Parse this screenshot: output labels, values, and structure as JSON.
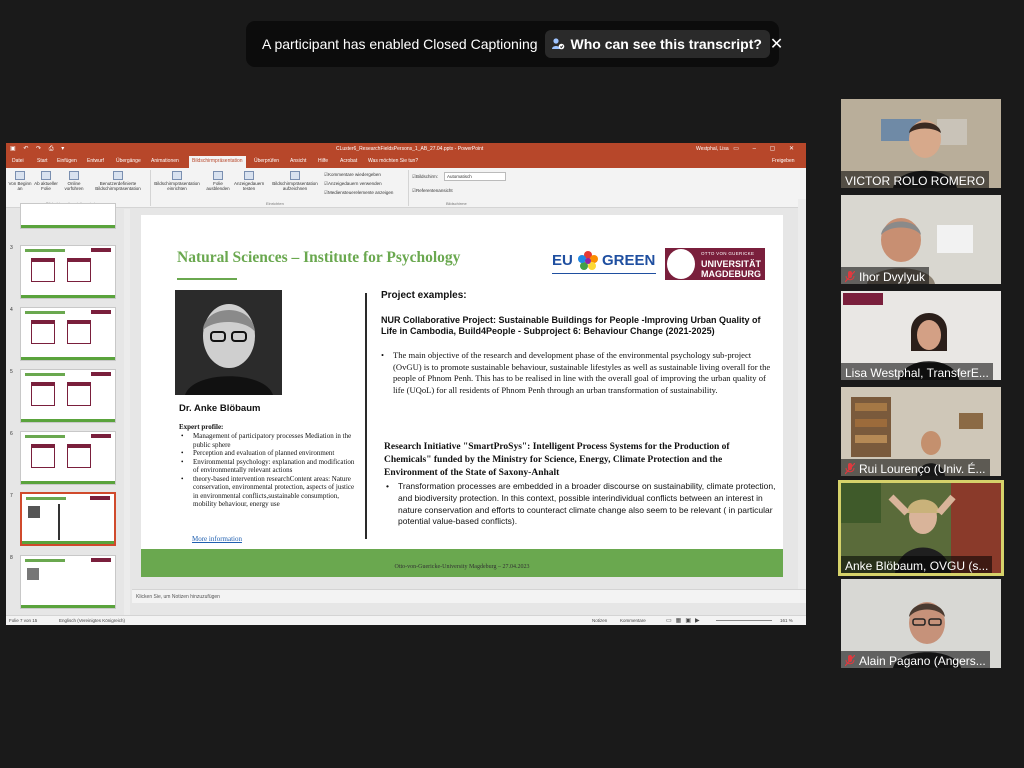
{
  "caption_banner": {
    "message": "A participant has enabled Closed Captioning",
    "transcript_button": "Who can see this transcript?",
    "close_icon": "close-icon"
  },
  "powerpoint": {
    "title": "CLuster6_ResearchFieldsPersons_1_AB_27.04.pptx  -  PowerPoint",
    "user": "Westphal, Lisa",
    "tabs": [
      "Datei",
      "Start",
      "Einfügen",
      "Entwurf",
      "Übergänge",
      "Animationen",
      "Bildschirmpräsentation",
      "Überprüfen",
      "Ansicht",
      "Hilfe",
      "Acrobat",
      "Was möchten Sie tun?",
      "Freigeben"
    ],
    "active_tab": "Bildschirmpräsentation",
    "ribbon": {
      "buttons": [
        "Von Beginn an",
        "Ab aktueller Folie",
        "Online vorführen",
        "Benutzerdefinierte Bildschirmpräsentation",
        "Bildschirmpräsentation einrichten",
        "Folie ausblenden",
        "Anzeigedauern testen",
        "Bildschirmpräsentation aufzeichnen"
      ],
      "checkboxes": [
        "Kommentare wiedergeben",
        "Anzeigedauern verwenden",
        "Medien­steuer­elemente anzeigen",
        "Referentenansicht"
      ],
      "monitor_label": "Bildschirm:",
      "monitor_value": "Automatisch",
      "groups": [
        "Bildschirmpräsentation starten",
        "Einrichten",
        "Bildschirme"
      ]
    },
    "thumbnails": [
      "3",
      "4",
      "5",
      "6",
      "7",
      "8"
    ],
    "selected_slide": "7",
    "notes_placeholder": "Klicken Sie, um Notizen hinzuzufügen",
    "status": {
      "slide_count": "Folie 7 von 15",
      "language": "Englisch (Vereinigtes Königreich)",
      "notes": "Notizen",
      "comments": "Kommentare",
      "zoom": "161 %"
    }
  },
  "slide": {
    "title": "Natural Sciences – Institute for Psychology",
    "logo_eu": "EU",
    "logo_green": "GREEN",
    "logo_ovgu_1": "OTTO VON GUERICKE",
    "logo_ovgu_2": "UNIVERSITÄT",
    "logo_ovgu_3": "MAGDEBURG",
    "person_name": "Dr. Anke Blöbaum",
    "expert_profile": "Expert profile:",
    "profile_items": [
      "Management of participatory processes Mediation in the public sphere",
      "Perception and evaluation of planned environment",
      "Environmental psychology: explanation and modification of environmentally relevant actions",
      "theory-based intervention researchContent areas: Nature conservation, environmental protection, aspects of justice in environmental conflicts,sustainable consumption, mobility behaviour, energy use"
    ],
    "more_info": "More information",
    "project_examples": "Project examples:",
    "project1_heading": "NUR Collaborative Project: Sustainable Buildings for People -Improving Urban Quality of Life in Cambodia, Build4People - Subproject 6: Behaviour Change (2021-2025)",
    "project1_text": "The main objective of the research and development phase of the environmental psychology sub-project (OvGU) is to promote sustainable behaviour, sustainable lifestyles as well as sustainable living overall for the people of Phnom Penh. This has to be realised in line with the overall goal of improving the urban quality of life (UQoL) for all residents of Phnom Penh through an urban transformation of sustainability.",
    "project2_heading": "Research Initiative \"SmartProSys\": Intelligent Process Systems for the Production of Chemicals\" funded by the Ministry for Science, Energy, Climate Protection and the Environment of the State of Saxony-Anhalt",
    "project2_text": "Transformation processes are embedded in a broader discourse on sustainability, climate protection, and biodiversity protection. In this context, possible interindividual conflicts between an interest in nature conservation and efforts to counteract climate change also seem to be relevant ( in particular potential value-based conflicts).",
    "footer": "Otto-von-Guericke-University Magdeburg – 27.04.2023"
  },
  "participants": [
    {
      "name": "VICTOR ROLO ROMERO",
      "muted": false
    },
    {
      "name": "Ihor Dvylyuk",
      "muted": true
    },
    {
      "name": "Lisa Westphal, TransferE...",
      "muted": false
    },
    {
      "name": "Rui Lourenço (Univ. É...",
      "muted": true
    },
    {
      "name": "Anke Blöbaum, OVGU (s...",
      "muted": false
    },
    {
      "name": "Alain Pagano (Angers...",
      "muted": true
    }
  ],
  "colors": {
    "ppt_accent": "#b7472a",
    "slide_green": "#6aa84f",
    "ovgu_red": "#7a1f3c",
    "active_speaker": "#d6d26a",
    "mute_red": "#e0393e"
  }
}
